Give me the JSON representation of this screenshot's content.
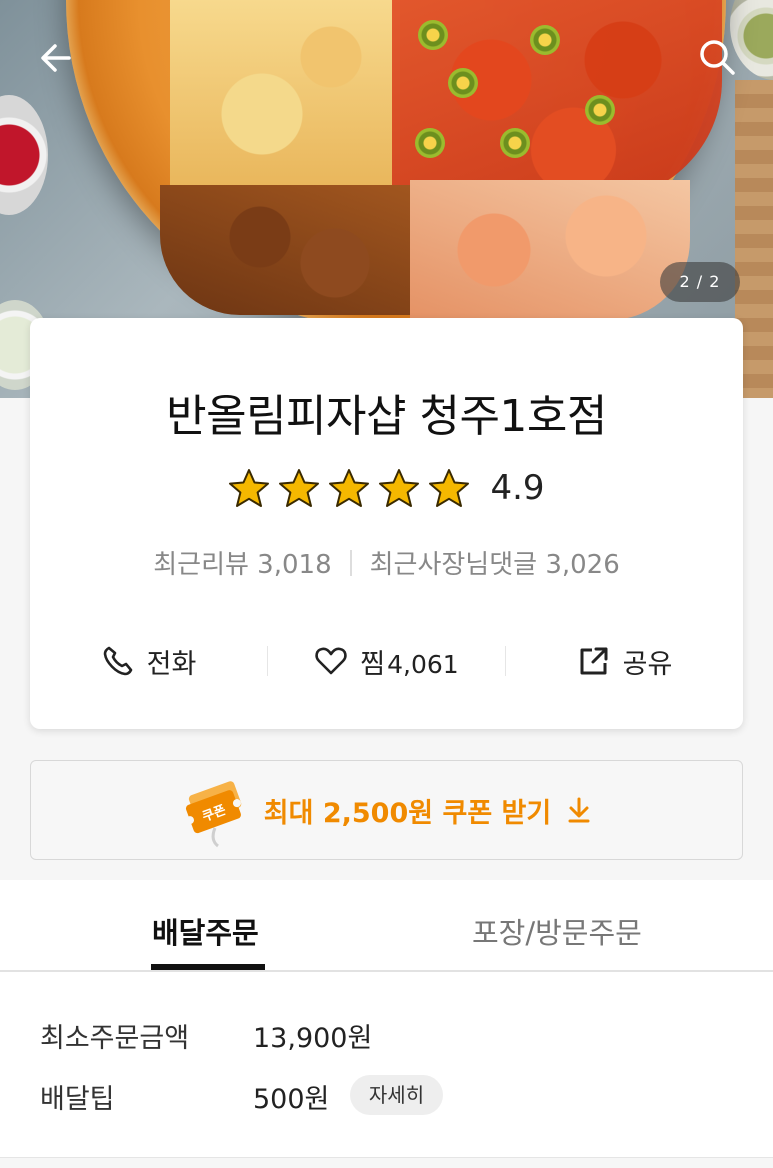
{
  "hero": {
    "image_alt": "pizza photo",
    "pager": "2 / 2"
  },
  "store": {
    "name": "반올림피자샵 청주1호점",
    "rating": "4.9",
    "stars": 5,
    "recent_reviews": "최근리뷰 3,018",
    "owner_replies": "최근사장님댓글 3,026"
  },
  "actions": {
    "call": "전화",
    "favorite": "찜",
    "favorite_count": "4,061",
    "share": "공유"
  },
  "coupon": {
    "badge": "쿠폰",
    "label": "최대 2,500원 쿠폰 받기"
  },
  "tabs": [
    {
      "label": "배달주문",
      "active": true
    },
    {
      "label": "포장/방문주문",
      "active": false
    }
  ],
  "details": {
    "min_order_label": "최소주문금액",
    "min_order_value": "13,900원",
    "delivery_tip_label": "배달팁",
    "delivery_tip_value": "500원",
    "detail_button": "자세히"
  },
  "colors": {
    "accent": "#f08a00",
    "star": "#f5b800",
    "text": "#222222"
  },
  "icons": [
    "back-arrow-icon",
    "search-icon",
    "star-icon",
    "phone-icon",
    "heart-icon",
    "share-icon",
    "coupon-ticket-icon",
    "download-arrow-icon"
  ]
}
